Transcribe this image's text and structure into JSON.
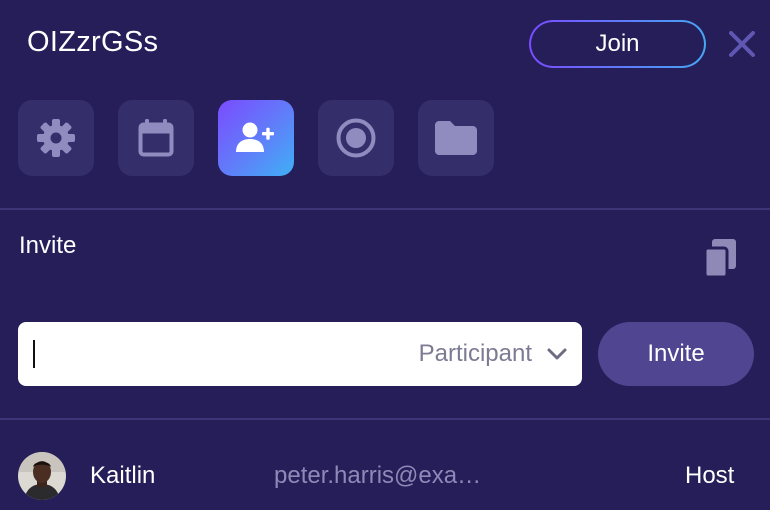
{
  "meeting": {
    "title": "OIZzrGSs",
    "join_label": "Join"
  },
  "toolbar": {
    "icons": [
      "gear-icon",
      "calendar-icon",
      "add-user-icon",
      "record-icon",
      "folder-icon"
    ],
    "active_index": 2
  },
  "invite": {
    "section_title": "Invite",
    "input_value": "",
    "role_selected": "Participant",
    "button_label": "Invite"
  },
  "participants": [
    {
      "name": "Kaitlin",
      "email": "peter.harris@exa…",
      "role": "Host"
    }
  ],
  "colors": {
    "background": "#251e58",
    "tile": "#342e6a",
    "accent_start": "#7b4bff",
    "accent_end": "#3fb0f6",
    "invite_button": "#4f4590"
  }
}
